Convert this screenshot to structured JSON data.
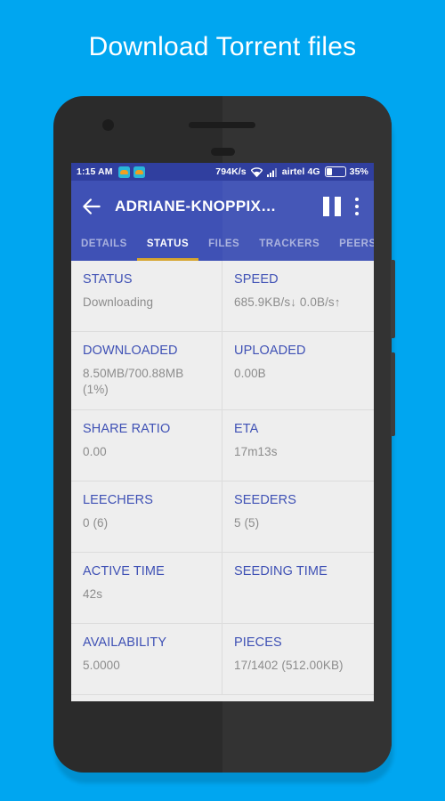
{
  "promo": {
    "title": "Download Torrent files"
  },
  "colors": {
    "page_background": "#00A6F0",
    "app_bar": "#3f51b5",
    "status_bar": "#303f9f",
    "tab_indicator": "#d6a52e",
    "label_text": "#3f51b5",
    "value_text": "#8c8c8c",
    "content_background": "#eeeeee"
  },
  "status_bar": {
    "clock": "1:15 AM",
    "notification_icons": [
      "download-cloud-icon",
      "download-cloud-icon"
    ],
    "network_speed": "794K/s",
    "wifi_icon": "wifi-icon",
    "signal_icon": "cellular-signal-icon",
    "carrier": "airtel 4G",
    "battery_icon": "battery-icon",
    "battery_percent": "35%"
  },
  "app_bar": {
    "back_icon": "arrow-back-icon",
    "title": "ADRIANE-KNOPPIX…",
    "pause_icon": "pause-icon",
    "overflow_icon": "more-vertical-icon"
  },
  "tabs": [
    {
      "label": "DETAILS",
      "active": false
    },
    {
      "label": "STATUS",
      "active": true
    },
    {
      "label": "FILES",
      "active": false
    },
    {
      "label": "TRACKERS",
      "active": false
    },
    {
      "label": "PEERS",
      "active": false
    }
  ],
  "stats": [
    {
      "label": "STATUS",
      "value": "Downloading"
    },
    {
      "label": "SPEED",
      "value": "685.9KB/s↓ 0.0B/s↑"
    },
    {
      "label": "DOWNLOADED",
      "value": "8.50MB/700.88MB (1%)"
    },
    {
      "label": "UPLOADED",
      "value": "0.00B"
    },
    {
      "label": "SHARE RATIO",
      "value": "0.00"
    },
    {
      "label": "ETA",
      "value": "17m13s"
    },
    {
      "label": "LEECHERS",
      "value": "0 (6)"
    },
    {
      "label": "SEEDERS",
      "value": "5 (5)"
    },
    {
      "label": "ACTIVE TIME",
      "value": "42s"
    },
    {
      "label": "SEEDING TIME",
      "value": ""
    },
    {
      "label": "AVAILABILITY",
      "value": "5.0000"
    },
    {
      "label": "PIECES",
      "value": "17/1402 (512.00KB)"
    }
  ]
}
